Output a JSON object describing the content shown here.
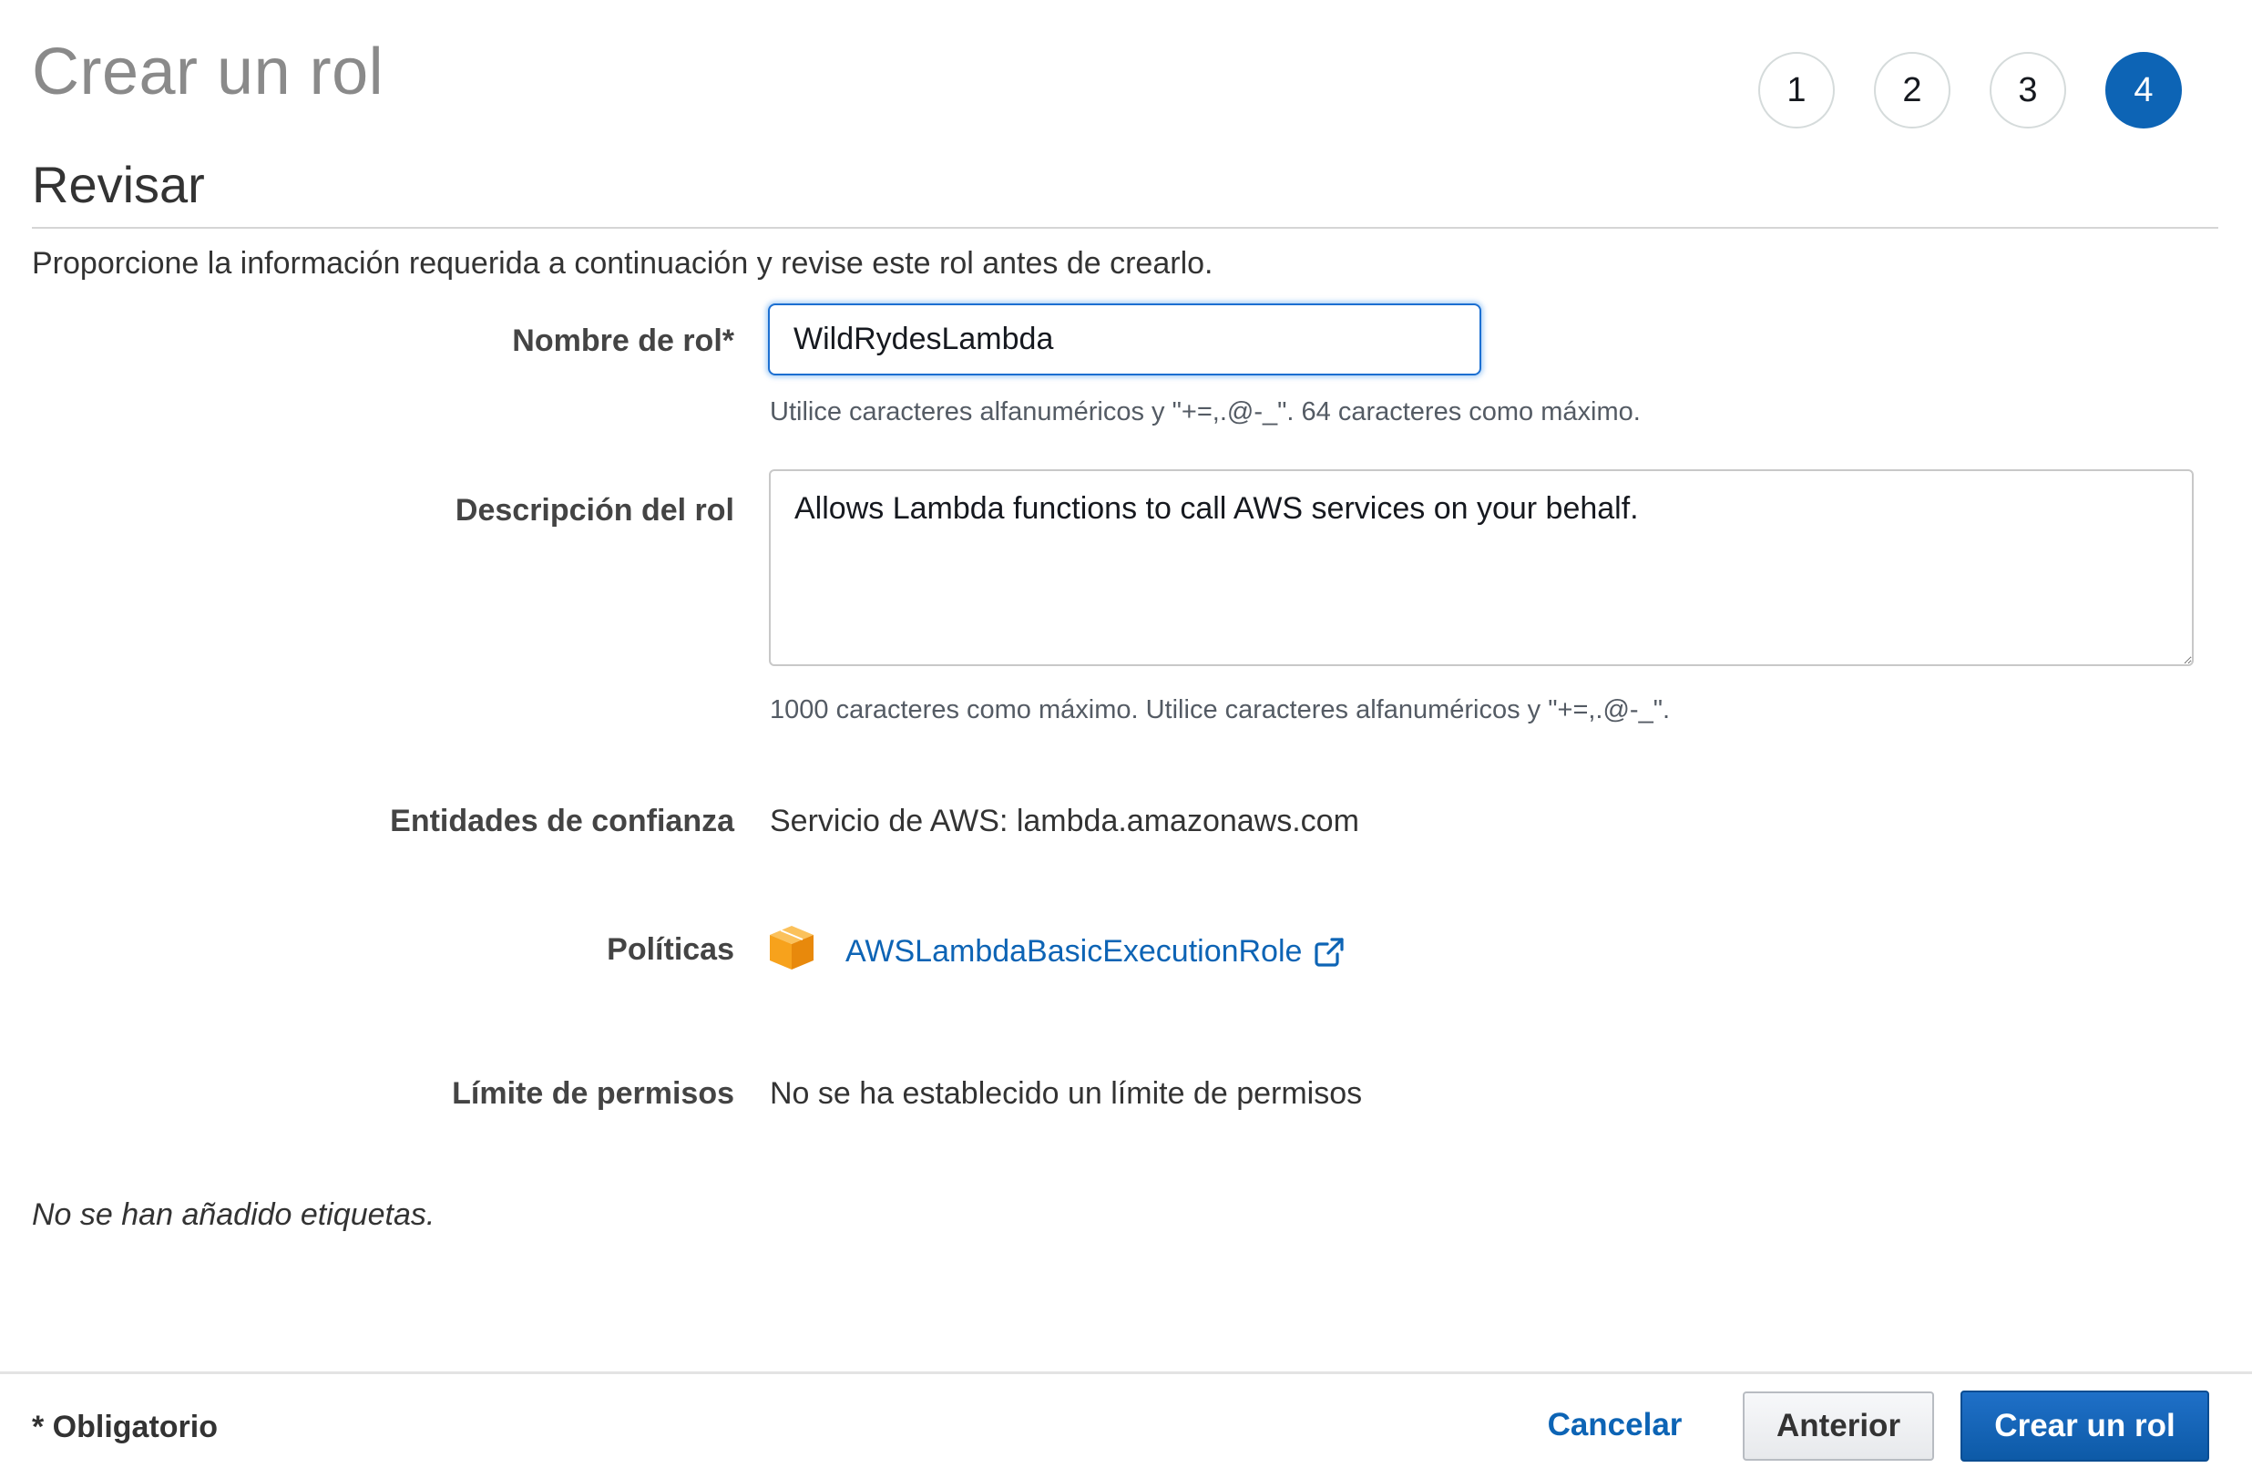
{
  "header": {
    "title": "Crear un rol",
    "steps": [
      "1",
      "2",
      "3",
      "4"
    ],
    "active_step": "4"
  },
  "section": {
    "title": "Revisar",
    "intro": "Proporcione la información requerida a continuación y revise este rol antes de crearlo."
  },
  "form": {
    "role_name": {
      "label": "Nombre de rol*",
      "value": "WildRydesLambda",
      "hint": "Utilice caracteres alfanuméricos y \"+=,.@-_\". 64 caracteres como máximo."
    },
    "description": {
      "label": "Descripción del rol",
      "value": "Allows Lambda functions to call AWS services on your behalf.",
      "hint": "1000 caracteres como máximo. Utilice caracteres alfanuméricos y \"+=,.@-_\"."
    },
    "trusted_entities": {
      "label": "Entidades de confianza",
      "value": "Servicio de AWS: lambda.amazonaws.com"
    },
    "policies": {
      "label": "Políticas",
      "policy_name": "AWSLambdaBasicExecutionRole",
      "icon": "aws-managed-policy-icon",
      "link_icon": "external-link-icon"
    },
    "permissions_boundary": {
      "label": "Límite de permisos",
      "value": "No se ha establecido un límite de permisos"
    },
    "tags_note": "No se han añadido etiquetas."
  },
  "footer": {
    "required_note": "* Obligatorio",
    "cancel_label": "Cancelar",
    "previous_label": "Anterior",
    "create_label": "Crear un rol"
  },
  "colors": {
    "accent": "#0d64b5",
    "policy_icon": "#f7a21c"
  }
}
